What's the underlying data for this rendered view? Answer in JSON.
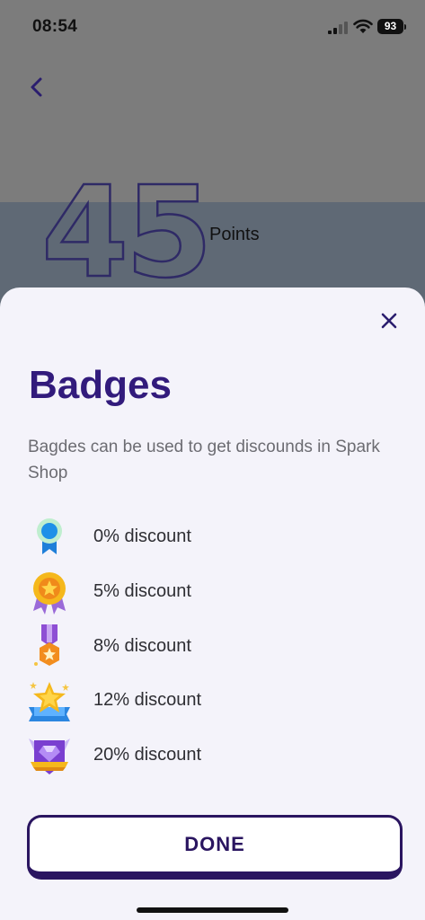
{
  "status_bar": {
    "time": "08:54",
    "battery": "93"
  },
  "header": {
    "points_value": "45",
    "points_label": "Points"
  },
  "sheet": {
    "title": "Badges",
    "subtitle": "Bagdes can be used to get discounds in Spark Shop",
    "badges": [
      {
        "icon": "ribbon-award-icon",
        "label": "0% discount"
      },
      {
        "icon": "gold-medal-icon",
        "label": "5% discount"
      },
      {
        "icon": "bronze-medal-icon",
        "label": "8% discount"
      },
      {
        "icon": "star-banner-icon",
        "label": "12% discount"
      },
      {
        "icon": "gem-shield-icon",
        "label": "20% discount"
      }
    ],
    "done_label": "DONE"
  },
  "colors": {
    "accent": "#321b7c",
    "sheet_bg": "#f4f3fa",
    "band": "#5f6975"
  }
}
